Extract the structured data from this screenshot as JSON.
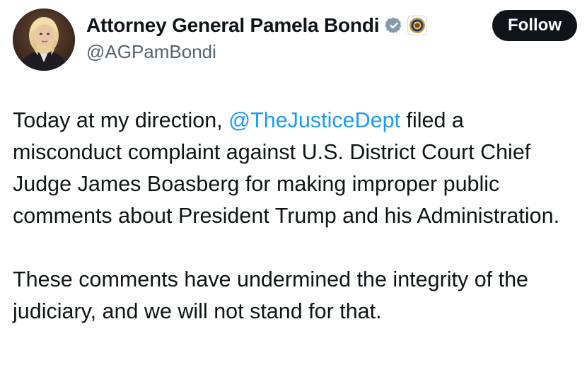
{
  "user": {
    "display_name": "Attorney General Pamela Bondi",
    "handle": "@AGPamBondi",
    "avatar_icon": "profile-photo",
    "verified_icon": "verified-badge-icon",
    "affiliation_icon": "doj-seal-icon"
  },
  "actions": {
    "follow_label": "Follow"
  },
  "post": {
    "p1_before": "Today at my direction, ",
    "p1_mention": "@TheJusticeDept",
    "p1_after": " filed a misconduct complaint against U.S. District Court Chief Judge James Boasberg for making improper public comments about President Trump and his Administration.",
    "p2": "These comments have undermined the integrity of the judiciary, and we will not stand for that."
  },
  "colors": {
    "link": "#1d9bf0",
    "text": "#0f1419",
    "secondary": "#536471",
    "button_bg": "#0f1419"
  }
}
